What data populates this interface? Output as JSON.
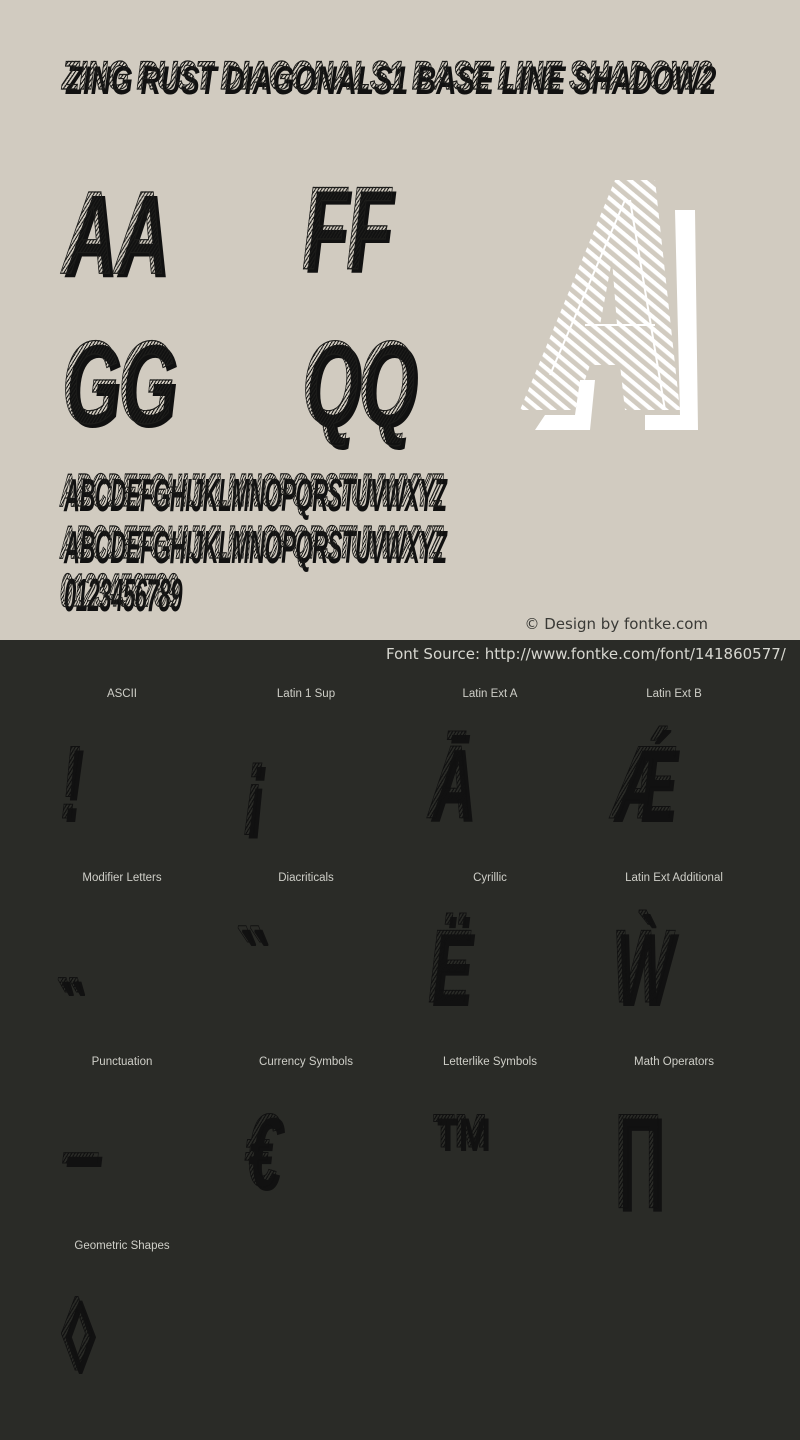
{
  "preview": {
    "title": "ZING RUST DIAGONALS1 BASE LINE SHADOW2",
    "pairs": [
      "AA",
      "FF",
      "GG",
      "QQ"
    ],
    "big_glyph": "A",
    "uppercase": "ABCDEFGHIJKLMNOPQRSTUVWXYZ",
    "lowercase": "ABCDEFGHIJKLMNOPQRSTUVWXYZ",
    "digits": "0123456789",
    "credit": "© Design by fontke.com"
  },
  "source": {
    "label": "Font Source: http://www.fontke.com/font/141860577/"
  },
  "colors": {
    "preview_bg": "#d1cbc0",
    "panel_bg": "#2a2b27",
    "glyph_ink": "#1d1d1b",
    "big_glyph_ink": "#ffffff"
  },
  "charsets": [
    {
      "label": "ASCII",
      "glyph": "!"
    },
    {
      "label": "Latin 1 Sup",
      "glyph": "¡"
    },
    {
      "label": "Latin Ext A",
      "glyph": "Ā"
    },
    {
      "label": "Latin Ext B",
      "glyph": "Ǽ"
    },
    {
      "label": "Modifier Letters",
      "glyph": "˵"
    },
    {
      "label": "Diacriticals",
      "glyph": "̏"
    },
    {
      "label": "Cyrillic",
      "glyph": "Ё"
    },
    {
      "label": "Latin Ext Additional",
      "glyph": "Ẁ"
    },
    {
      "label": "Punctuation",
      "glyph": "‒"
    },
    {
      "label": "Currency Symbols",
      "glyph": "€"
    },
    {
      "label": "Letterlike Symbols",
      "glyph": "™"
    },
    {
      "label": "Math Operators",
      "glyph": "∏"
    },
    {
      "label": "Geometric Shapes",
      "glyph": "◊"
    }
  ]
}
